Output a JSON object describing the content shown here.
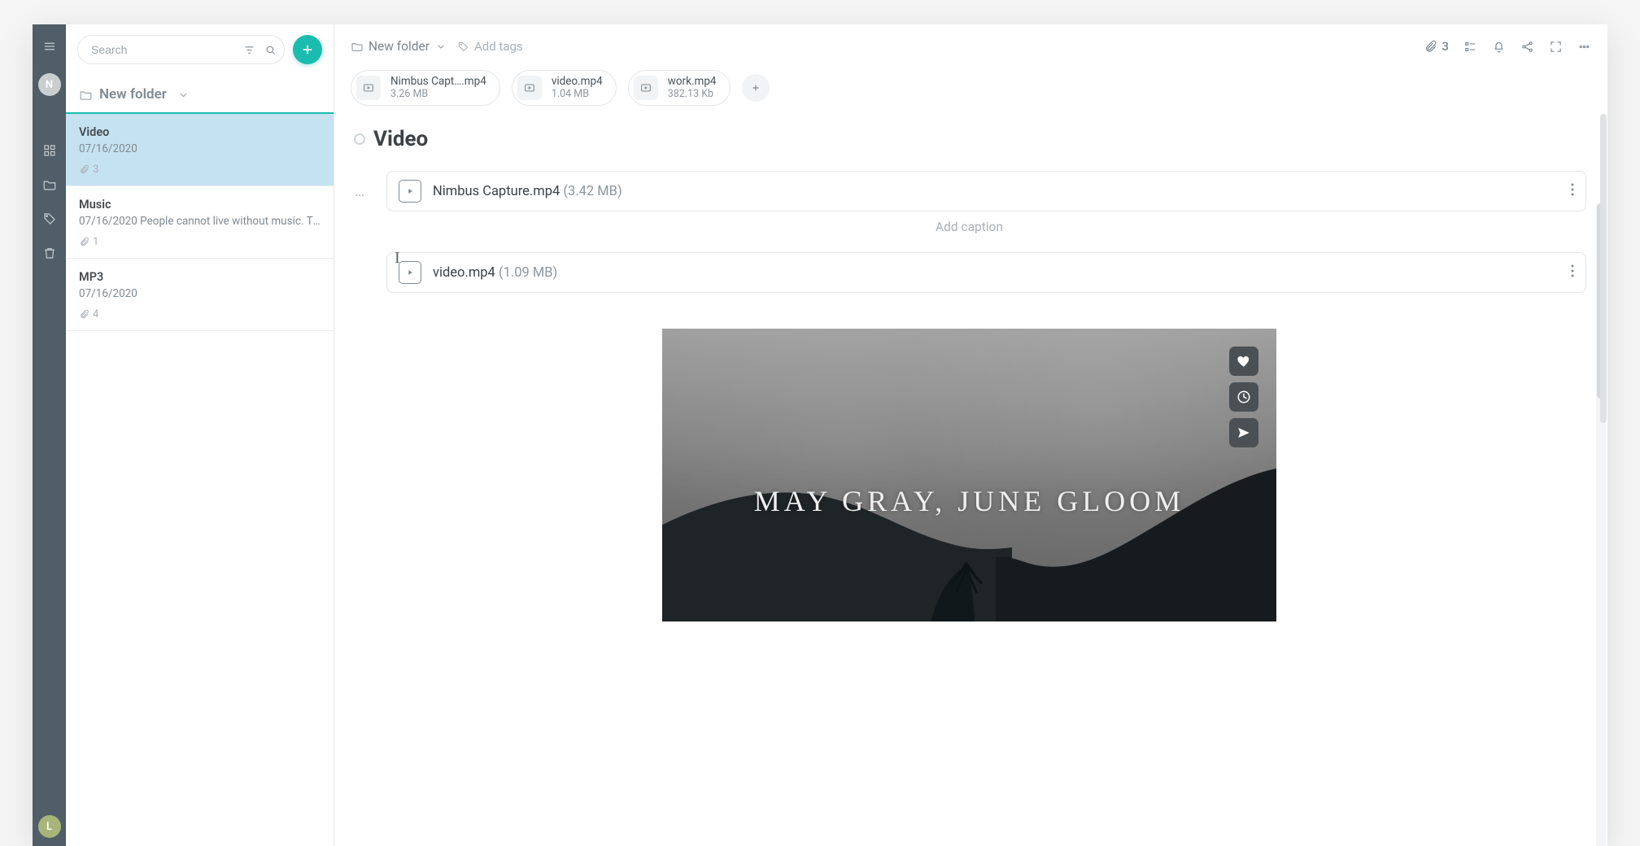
{
  "rail": {
    "top_avatar_letter": "N",
    "bottom_avatar_letter": "L"
  },
  "search": {
    "placeholder": "Search"
  },
  "folder_header": {
    "label": "New folder"
  },
  "notes": [
    {
      "title": "Video",
      "sub": "07/16/2020",
      "att_count": "3",
      "selected": true
    },
    {
      "title": "Music",
      "sub": "07/16/2020 People cannot live without music. They l…",
      "att_count": "1",
      "selected": false
    },
    {
      "title": "MP3",
      "sub": "07/16/2020",
      "att_count": "4",
      "selected": false
    }
  ],
  "topbar": {
    "crumb_label": "New folder",
    "add_tags_label": "Add tags",
    "clip_count": "3"
  },
  "chips": [
    {
      "name": "Nimbus Capt….mp4",
      "size": "3.26 MB"
    },
    {
      "name": "video.mp4",
      "size": "1.04 MB"
    },
    {
      "name": "work.mp4",
      "size": "382.13 Kb"
    }
  ],
  "content": {
    "title": "Video",
    "files": [
      {
        "name": "Nimbus Capture.mp4",
        "size": "(3.42 MB)"
      },
      {
        "name": "video.mp4",
        "size": "(1.09 MB)"
      }
    ],
    "caption_placeholder": "Add caption",
    "video_overlay_text": "MAY GRAY, JUNE GLOOM"
  }
}
